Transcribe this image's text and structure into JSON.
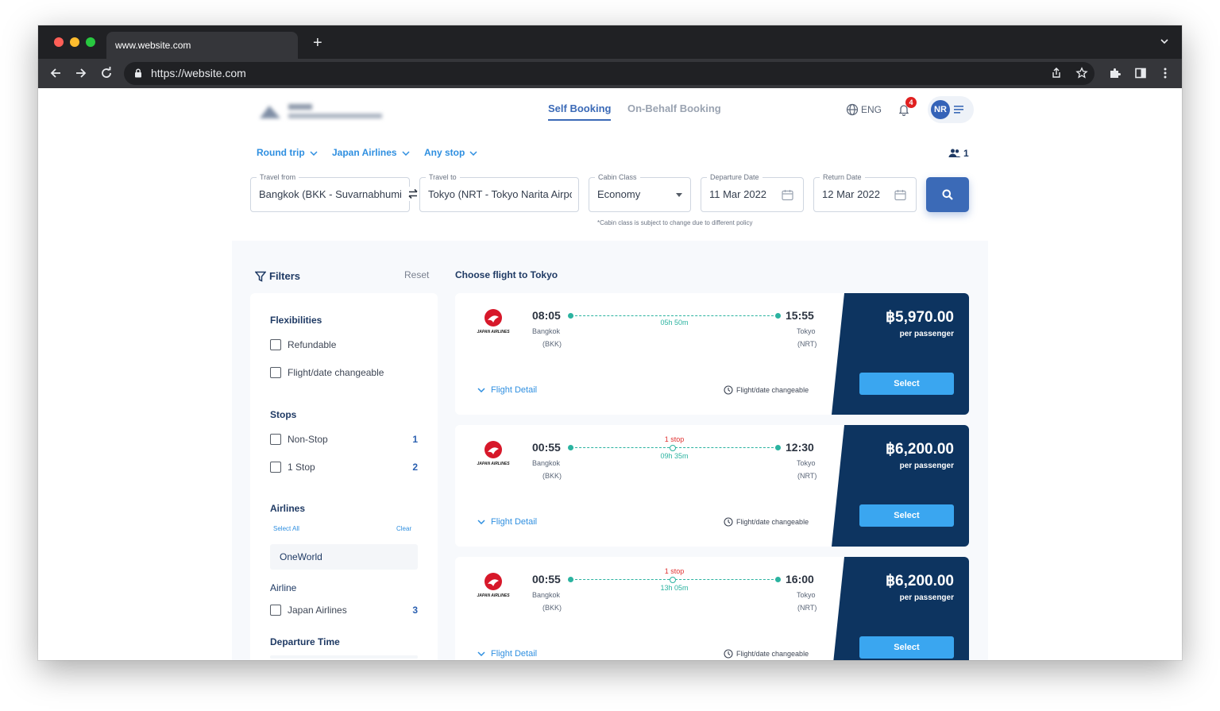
{
  "browser": {
    "tab_title": "www.website.com",
    "url": "https://website.com",
    "traffic_colors": [
      "#ff5f57",
      "#febc2e",
      "#28c840"
    ]
  },
  "header": {
    "tabs": [
      {
        "label": "Self Booking",
        "active": true
      },
      {
        "label": "On-Behalf Booking",
        "active": false
      }
    ],
    "language": "ENG",
    "notification_count": "4",
    "user_initials": "NR"
  },
  "search": {
    "trip_type": "Round trip",
    "airline": "Japan Airlines",
    "stops": "Any stop",
    "passengers": "1",
    "from_label": "Travel from",
    "from_value": "Bangkok (BKK - Suvarnabhumi I",
    "to_label": "Travel to",
    "to_value": "Tokyo (NRT - Tokyo Narita Airpo",
    "cabin_label": "Cabin Class",
    "cabin_value": "Economy",
    "departure_label": "Departure Date",
    "departure_value": "11 Mar 2022",
    "return_label": "Return Date",
    "return_value": "12 Mar 2022",
    "cabin_note": "*Cabin class is subject to change due to different policy"
  },
  "filters": {
    "title": "Filters",
    "reset": "Reset",
    "flexibilities_title": "Flexibilities",
    "refundable": "Refundable",
    "changeable": "Flight/date changeable",
    "stops_title": "Stops",
    "nonstop": "Non-Stop",
    "nonstop_count": "1",
    "one_stop": "1 Stop",
    "one_stop_count": "2",
    "airlines_title": "Airlines",
    "select_all": "Select All",
    "clear": "Clear",
    "alliance": "OneWorld",
    "airline_title": "Airline",
    "airline_name": "Japan Airlines",
    "airline_count": "3",
    "departure_time_title": "Departure Time"
  },
  "results": {
    "heading": "Choose flight to Tokyo",
    "airline_logo_text": "JAPAN AIRLINES",
    "flight_detail": "Flight Detail",
    "changeable_label": "Flight/date changeable",
    "per_passenger": "per passenger",
    "select": "Select",
    "flights": [
      {
        "dep_time": "08:05",
        "dep_city": "Bangkok",
        "dep_code": "(BKK)",
        "arr_time": "15:55",
        "arr_city": "Tokyo",
        "arr_code": "(NRT)",
        "duration": "05h 50m",
        "stops": "",
        "price": "฿5,970.00"
      },
      {
        "dep_time": "00:55",
        "dep_city": "Bangkok",
        "dep_code": "(BKK)",
        "arr_time": "12:30",
        "arr_city": "Tokyo",
        "arr_code": "(NRT)",
        "duration": "09h 35m",
        "stops": "1 stop",
        "price": "฿6,200.00"
      },
      {
        "dep_time": "00:55",
        "dep_city": "Bangkok",
        "dep_code": "(BKK)",
        "arr_time": "16:00",
        "arr_city": "Tokyo",
        "arr_code": "(NRT)",
        "duration": "13h 05m",
        "stops": "1 stop",
        "price": "฿6,200.00"
      }
    ]
  },
  "colors": {
    "primary": "#3b6ab7",
    "navy": "#0d3460",
    "accent_blue": "#2f8fe0",
    "route_green": "#2bb3a0",
    "stop_red": "#e03131"
  }
}
